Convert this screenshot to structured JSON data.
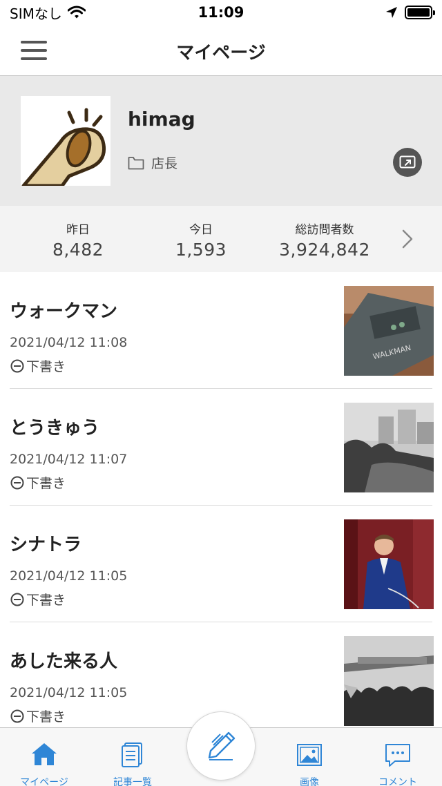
{
  "status_bar": {
    "carrier": "SIMなし",
    "time": "11:09"
  },
  "nav": {
    "title": "マイページ"
  },
  "profile": {
    "name": "himag",
    "role": "店長"
  },
  "stats": [
    {
      "label": "昨日",
      "value": "8,482"
    },
    {
      "label": "今日",
      "value": "1,593"
    },
    {
      "label": "総訪問者数",
      "value": "3,924,842"
    }
  ],
  "articles": [
    {
      "title": "ウォークマン",
      "date": "2021/04/12 11:08",
      "status": "下書き"
    },
    {
      "title": "とうきゅう",
      "date": "2021/04/12 11:07",
      "status": "下書き"
    },
    {
      "title": "シナトラ",
      "date": "2021/04/12 11:05",
      "status": "下書き"
    },
    {
      "title": "あした来る人",
      "date": "2021/04/12 11:05",
      "status": "下書き"
    }
  ],
  "tabs": [
    {
      "label": "マイページ",
      "icon": "home-icon",
      "active": true
    },
    {
      "label": "記事一覧",
      "icon": "document-list-icon",
      "active": false
    },
    {
      "label": "画像",
      "icon": "image-icon",
      "active": false
    },
    {
      "label": "コメント",
      "icon": "comment-icon",
      "active": false
    }
  ],
  "colors": {
    "accent": "#2f86d6",
    "profile_bg": "#e9e9e9",
    "stats_bg": "#f3f3f3"
  }
}
